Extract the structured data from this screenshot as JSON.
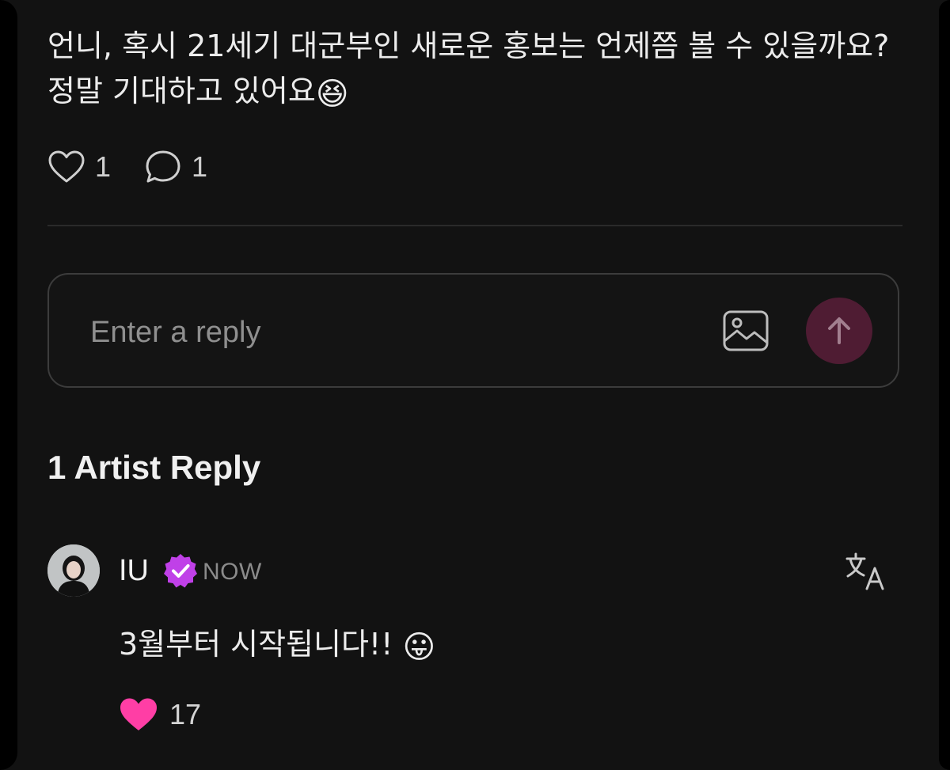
{
  "post": {
    "text": "언니, 혹시 21세기 대군부인 새로운 홍보는 언제쯤 볼 수 있을까요? 정말 기대하고 있어요",
    "emoji": "😆",
    "like_count": "1",
    "comment_count": "1"
  },
  "reply_box": {
    "placeholder": "Enter a reply"
  },
  "artist_replies": {
    "title": "1 Artist Reply",
    "items": [
      {
        "author": "IU",
        "timestamp": "NOW",
        "text": "3월부터 시작됩니다!!",
        "emoji": "😛",
        "like_count": "17"
      }
    ]
  },
  "colors": {
    "background": "#121212",
    "send_button": "#4f1c33",
    "verified_badge": "#c040e8",
    "liked_heart": "#ff3ea5"
  }
}
